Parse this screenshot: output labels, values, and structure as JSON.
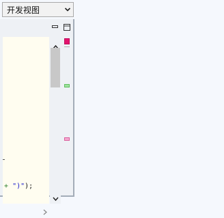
{
  "view_selector": {
    "selected": "开发视图",
    "chevron_icon": "chevron-down-icon"
  },
  "panel": {
    "minimize_icon": "minimize-icon",
    "restore_icon": "restore-icon"
  },
  "editor": {
    "code_line": {
      "operator": "+",
      "string_literal": "\")\"",
      "tail": ");"
    },
    "background_color": "#fffdf0"
  },
  "overview_ruler": {
    "markers": [
      {
        "kind": "error",
        "color": "#e4146e"
      },
      {
        "kind": "change",
        "color": "#9ee29e"
      },
      {
        "kind": "warning",
        "color": "#f5a9d0"
      }
    ]
  }
}
